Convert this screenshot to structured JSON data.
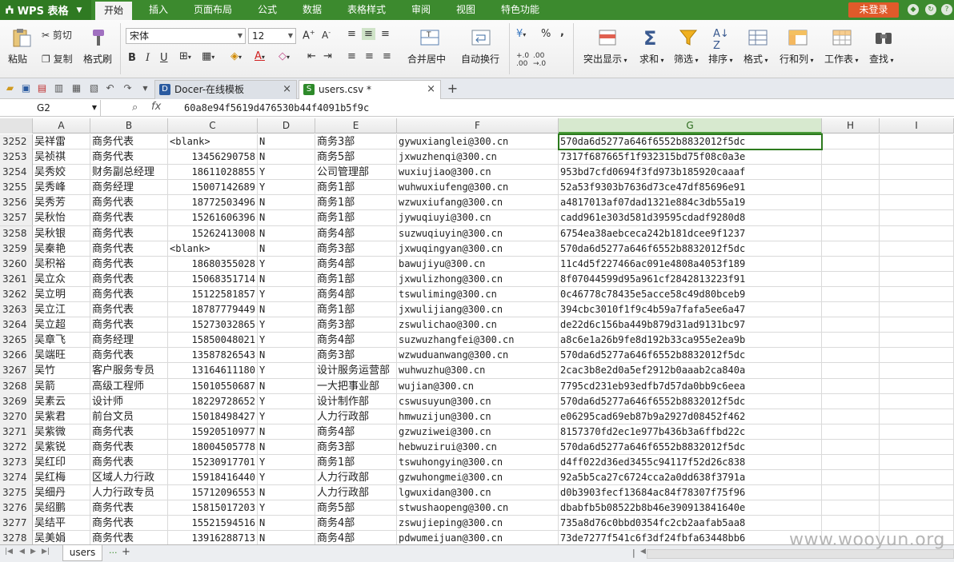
{
  "app": {
    "name": "WPS 表格",
    "login_label": "未登录"
  },
  "menu": [
    "开始",
    "插入",
    "页面布局",
    "公式",
    "数据",
    "表格样式",
    "审阅",
    "视图",
    "特色功能"
  ],
  "ribbon": {
    "paste": "粘贴",
    "cut": "剪切",
    "copy": "复制",
    "format_painter": "格式刷",
    "font": "宋体",
    "size": "12",
    "bold": "B",
    "italic": "I",
    "underline": "U",
    "merge_center": "合并居中",
    "wrap_text": "自动换行",
    "percent": "%",
    "comma": ",",
    "highlight": "突出显示",
    "sum": "求和",
    "filter": "筛选",
    "sort": "排序",
    "format": "格式",
    "rows_cols": "行和列",
    "worksheet": "工作表",
    "find": "查找"
  },
  "tabs": [
    {
      "label": "Docer-在线模板",
      "icon": "D"
    },
    {
      "label": "users.csv *",
      "icon": "S"
    }
  ],
  "namebox": "G2",
  "formula": "60a8e94f5619d476530b44f4091b5f9c",
  "columns": [
    "A",
    "B",
    "C",
    "D",
    "E",
    "F",
    "G",
    "H",
    "I"
  ],
  "rows": [
    {
      "n": "3252",
      "a": "吴祥雷",
      "b": "商务代表",
      "c": "<blank>",
      "d": "N",
      "e": "商务3部",
      "f": "gywuxianglei@300.cn",
      "g": "570da6d5277a646f6552b8832012f5dc"
    },
    {
      "n": "3253",
      "a": "吴祯祺",
      "b": "商务代表",
      "c": "13456290758",
      "d": "N",
      "e": "商务5部",
      "f": "jxwuzhenqi@300.cn",
      "g": "7317f687665f1f932315bd75f08c0a3e"
    },
    {
      "n": "3254",
      "a": "吴秀姣",
      "b": "财务副总经理",
      "c": "18611028855",
      "d": "Y",
      "e": "公司管理部",
      "f": "wuxiujiao@300.cn",
      "g": "953bd7cfd0694f3fd973b185920caaaf"
    },
    {
      "n": "3255",
      "a": "吴秀峰",
      "b": "商务经理",
      "c": "15007142689",
      "d": "Y",
      "e": "商务1部",
      "f": "wuhwuxiufeng@300.cn",
      "g": "52a53f9303b7636d73ce47df85696e91"
    },
    {
      "n": "3256",
      "a": "吴秀芳",
      "b": "商务代表",
      "c": "18772503496",
      "d": "N",
      "e": "商务1部",
      "f": "wzwuxiufang@300.cn",
      "g": "a4817013af07dad1321e884c3db55a19"
    },
    {
      "n": "3257",
      "a": "吴秋怡",
      "b": "商务代表",
      "c": "15261606396",
      "d": "N",
      "e": "商务1部",
      "f": "jywuqiuyi@300.cn",
      "g": "cadd961e303d581d39595cdadf9280d8"
    },
    {
      "n": "3258",
      "a": "吴秋银",
      "b": "商务代表",
      "c": "15262413008",
      "d": "N",
      "e": "商务4部",
      "f": "suzwuqiuyin@300.cn",
      "g": "6754ea38aebceca242b181dcee9f1237"
    },
    {
      "n": "3259",
      "a": "吴秦艳",
      "b": "商务代表",
      "c": "<blank>",
      "d": "N",
      "e": "商务3部",
      "f": "jxwuqingyan@300.cn",
      "g": "570da6d5277a646f6552b8832012f5dc"
    },
    {
      "n": "3260",
      "a": "吴积裕",
      "b": "商务代表",
      "c": "18680355028",
      "d": "Y",
      "e": "商务4部",
      "f": "bawujiyu@300.cn",
      "g": "11c4d5f227466ac091e4808a4053f189"
    },
    {
      "n": "3261",
      "a": "吴立众",
      "b": "商务代表",
      "c": "15068351714",
      "d": "N",
      "e": "商务1部",
      "f": "jxwulizhong@300.cn",
      "g": "8f07044599d95a961cf2842813223f91"
    },
    {
      "n": "3262",
      "a": "吴立明",
      "b": "商务代表",
      "c": "15122581857",
      "d": "Y",
      "e": "商务4部",
      "f": "tswuliming@300.cn",
      "g": "0c46778c78435e5acce58c49d80bceb9"
    },
    {
      "n": "3263",
      "a": "吴立江",
      "b": "商务代表",
      "c": "18787779449",
      "d": "N",
      "e": "商务1部",
      "f": "jxwulijiang@300.cn",
      "g": "394cbc3010f1f9c4b59a7fafa5ee6a47"
    },
    {
      "n": "3264",
      "a": "吴立超",
      "b": "商务代表",
      "c": "15273032865",
      "d": "Y",
      "e": "商务3部",
      "f": "zswulichao@300.cn",
      "g": "de22d6c156ba449b879d31ad9131bc97"
    },
    {
      "n": "3265",
      "a": "吴章飞",
      "b": "商务经理",
      "c": "15850048021",
      "d": "Y",
      "e": "商务4部",
      "f": "suzwuzhangfei@300.cn",
      "g": "a8c6e1a26b9fe8d192b33ca955e2ea9b"
    },
    {
      "n": "3266",
      "a": "吴端旺",
      "b": "商务代表",
      "c": "13587826543",
      "d": "N",
      "e": "商务3部",
      "f": "wzwuduanwang@300.cn",
      "g": "570da6d5277a646f6552b8832012f5dc"
    },
    {
      "n": "3267",
      "a": "吴竹",
      "b": "客户服务专员",
      "c": "13164611180",
      "d": "Y",
      "e": "设计服务运营部",
      "f": "wuhwuzhu@300.cn",
      "g": "2cac3b8e2d0a5ef2912b0aaab2ca840a"
    },
    {
      "n": "3268",
      "a": "吴箭",
      "b": "高级工程师",
      "c": "15010550687",
      "d": "N",
      "e": "一大把事业部",
      "f": "wujian@300.cn",
      "g": "7795cd231eb93edfb7d57da0bb9c6eea"
    },
    {
      "n": "3269",
      "a": "吴素云",
      "b": "设计师",
      "c": "18229728652",
      "d": "Y",
      "e": "设计制作部",
      "f": "cswusuyun@300.cn",
      "g": "570da6d5277a646f6552b8832012f5dc"
    },
    {
      "n": "3270",
      "a": "吴紫君",
      "b": "前台文员",
      "c": "15018498427",
      "d": "Y",
      "e": "人力行政部",
      "f": "hmwuzijun@300.cn",
      "g": "e06295cad69eb87b9a2927d08452f462"
    },
    {
      "n": "3271",
      "a": "吴紫微",
      "b": "商务代表",
      "c": "15920510977",
      "d": "N",
      "e": "商务4部",
      "f": "gzwuziwei@300.cn",
      "g": "8157370fd2ec1e977b436b3a6ffbd22c"
    },
    {
      "n": "3272",
      "a": "吴紫锐",
      "b": "商务代表",
      "c": "18004505778",
      "d": "N",
      "e": "商务3部",
      "f": "hebwuzirui@300.cn",
      "g": "570da6d5277a646f6552b8832012f5dc"
    },
    {
      "n": "3273",
      "a": "吴红印",
      "b": "商务代表",
      "c": "15230917701",
      "d": "Y",
      "e": "商务1部",
      "f": "tswuhongyin@300.cn",
      "g": "d4ff022d36ed3455c94117f52d26c838"
    },
    {
      "n": "3274",
      "a": "吴红梅",
      "b": "区域人力行政",
      "c": "15918416440",
      "d": "Y",
      "e": "人力行政部",
      "f": "gzwuhongmei@300.cn",
      "g": "92a5b5ca27c6724cca2a0dd638f3791a"
    },
    {
      "n": "3275",
      "a": "吴细丹",
      "b": "人力行政专员",
      "c": "15712096553",
      "d": "N",
      "e": "人力行政部",
      "f": "lgwuxidan@300.cn",
      "g": "d0b3903fecf13684ac84f78307f75f96"
    },
    {
      "n": "3276",
      "a": "吴绍鹏",
      "b": "商务代表",
      "c": "15815017203",
      "d": "Y",
      "e": "商务5部",
      "f": "stwushaopeng@300.cn",
      "g": "dbabfb5b08522b8b46e390913841640e"
    },
    {
      "n": "3277",
      "a": "吴结平",
      "b": "商务代表",
      "c": "15521594516",
      "d": "N",
      "e": "商务4部",
      "f": "zswujieping@300.cn",
      "g": "735a8d76c0bbd0354fc2cb2aafab5aa8"
    },
    {
      "n": "3278",
      "a": "吴美娟",
      "b": "商务代表",
      "c": "13916288713",
      "d": "N",
      "e": "商务4部",
      "f": "pdwumeijuan@300.cn",
      "g": "73de7277f541c6f3df24fbfa63448bb6"
    }
  ],
  "sheet_tab": "users",
  "watermark": "www.wooyun.org"
}
